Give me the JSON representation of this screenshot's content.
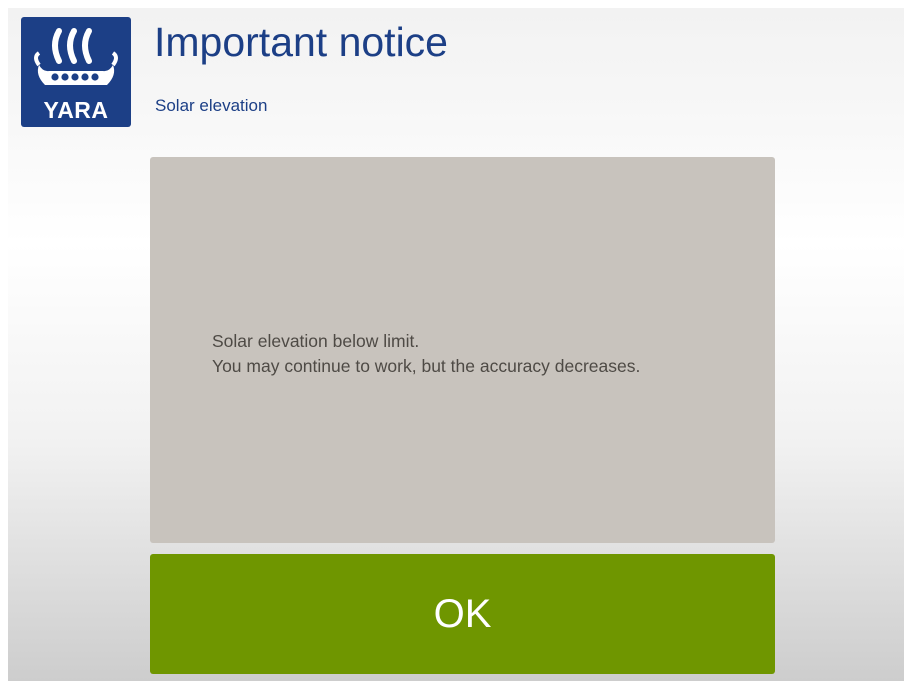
{
  "header": {
    "logo_text": "YARA",
    "title": "Important notice",
    "subtitle": "Solar elevation"
  },
  "message": {
    "line1": "Solar elevation below limit.",
    "line2": "You may continue to work, but the accuracy decreases."
  },
  "actions": {
    "ok_label": "OK"
  },
  "colors": {
    "brand_blue": "#1c3f86",
    "panel_gray": "#c8c3bd",
    "ok_green": "#6f9600"
  },
  "icons": {
    "logo": "viking-ship-logo-icon"
  }
}
